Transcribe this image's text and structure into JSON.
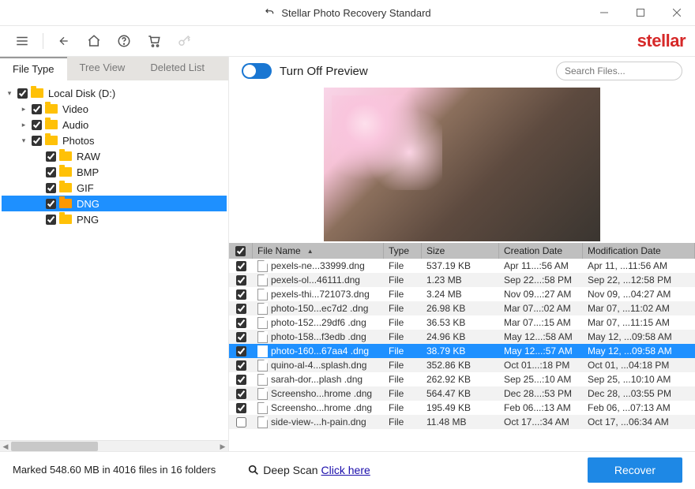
{
  "title": "Stellar Photo Recovery Standard",
  "logo": "stellar",
  "tabs": {
    "file_type": "File Type",
    "tree_view": "Tree View",
    "deleted": "Deleted List"
  },
  "tree": {
    "root": {
      "label": "Local Disk (D:)",
      "checked": true
    },
    "items": [
      {
        "label": "Video",
        "checked": true,
        "expandable": true
      },
      {
        "label": "Audio",
        "checked": true,
        "expandable": true
      },
      {
        "label": "Photos",
        "checked": true,
        "expanded": true,
        "children": [
          {
            "label": "RAW",
            "checked": true
          },
          {
            "label": "BMP",
            "checked": true
          },
          {
            "label": "GIF",
            "checked": true
          },
          {
            "label": "DNG",
            "checked": true,
            "selected": true
          },
          {
            "label": "PNG",
            "checked": true
          }
        ]
      }
    ]
  },
  "preview_toggle": "Turn Off Preview",
  "search_placeholder": "Search Files...",
  "columns": {
    "name": "File Name",
    "type": "Type",
    "size": "Size",
    "cd": "Creation Date",
    "md": "Modification Date"
  },
  "rows": [
    {
      "chk": true,
      "name": "pexels-ne...33999.dng",
      "type": "File",
      "size": "537.19 KB",
      "cd": "Apr 11...:56 AM",
      "md": "Apr 11, ...11:56 AM"
    },
    {
      "chk": true,
      "name": "pexels-ol...46111.dng",
      "type": "File",
      "size": "1.23 MB",
      "cd": "Sep 22...:58 PM",
      "md": "Sep 22, ...12:58 PM"
    },
    {
      "chk": true,
      "name": "pexels-thi...721073.dng",
      "type": "File",
      "size": "3.24 MB",
      "cd": "Nov 09...:27 AM",
      "md": "Nov 09, ...04:27 AM"
    },
    {
      "chk": true,
      "name": "photo-150...ec7d2 .dng",
      "type": "File",
      "size": "26.98 KB",
      "cd": "Mar 07...:02 AM",
      "md": "Mar 07, ...11:02 AM"
    },
    {
      "chk": true,
      "name": "photo-152...29df6 .dng",
      "type": "File",
      "size": "36.53 KB",
      "cd": "Mar 07...:15 AM",
      "md": "Mar 07, ...11:15 AM"
    },
    {
      "chk": true,
      "name": "photo-158...f3edb .dng",
      "type": "File",
      "size": "24.96 KB",
      "cd": "May 12...:58 AM",
      "md": "May 12, ...09:58 AM"
    },
    {
      "chk": true,
      "name": "photo-160...67aa4 .dng",
      "type": "File",
      "size": "38.79 KB",
      "cd": "May 12...:57 AM",
      "md": "May 12, ...09:58 AM",
      "selected": true
    },
    {
      "chk": true,
      "name": "quino-al-4...splash.dng",
      "type": "File",
      "size": "352.86 KB",
      "cd": "Oct 01...:18 PM",
      "md": "Oct 01, ...04:18 PM"
    },
    {
      "chk": true,
      "name": "sarah-dor...plash .dng",
      "type": "File",
      "size": "262.92 KB",
      "cd": "Sep 25...:10 AM",
      "md": "Sep 25, ...10:10 AM"
    },
    {
      "chk": true,
      "name": "Screensho...hrome .dng",
      "type": "File",
      "size": "564.47 KB",
      "cd": "Dec 28...:53 PM",
      "md": "Dec 28, ...03:55 PM"
    },
    {
      "chk": true,
      "name": "Screensho...hrome .dng",
      "type": "File",
      "size": "195.49 KB",
      "cd": "Feb 06...:13 AM",
      "md": "Feb 06, ...07:13 AM"
    },
    {
      "chk": false,
      "name": "side-view-...h-pain.dng",
      "type": "File",
      "size": "11.48 MB",
      "cd": "Oct 17...:34 AM",
      "md": "Oct 17, ...06:34 AM"
    }
  ],
  "status": "Marked 548.60 MB in 4016 files in 16 folders",
  "deep_scan": "Deep Scan",
  "deep_link": "Click here",
  "recover": "Recover"
}
